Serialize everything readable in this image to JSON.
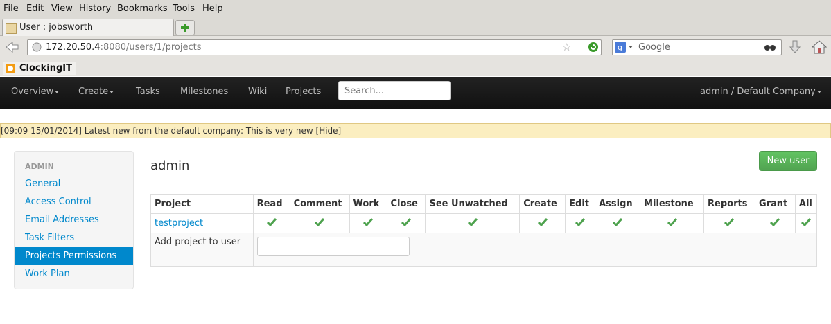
{
  "browser": {
    "menu": [
      "File",
      "Edit",
      "View",
      "History",
      "Bookmarks",
      "Tools",
      "Help"
    ],
    "tab_title": "User : jobsworth",
    "url_host": "172.20.50.4",
    "url_rest": ":8080/users/1/projects",
    "search_placeholder": "Google",
    "bookmark": "ClockingIT"
  },
  "nav": {
    "overview": "Overview",
    "create": "Create",
    "tasks": "Tasks",
    "milestones": "Milestones",
    "wiki": "Wiki",
    "projects": "Projects",
    "search_placeholder": "Search...",
    "user": "admin / Default Company"
  },
  "notice": "[09:09 15/01/2014] Latest new from the default company: This is very new [Hide]",
  "sidebar": {
    "header": "ADMIN",
    "items": [
      "General",
      "Access Control",
      "Email Addresses",
      "Task Filters",
      "Projects Permissions",
      "Work Plan"
    ],
    "active_index": 4
  },
  "page": {
    "title": "admin",
    "new_user_label": "New user"
  },
  "table": {
    "headers": [
      "Project",
      "Read",
      "Comment",
      "Work",
      "Close",
      "See Unwatched",
      "Create",
      "Edit",
      "Assign",
      "Milestone",
      "Reports",
      "Grant",
      "All"
    ],
    "rows": [
      {
        "project": "testproject",
        "perms": [
          true,
          true,
          true,
          true,
          true,
          true,
          true,
          true,
          true,
          true,
          true,
          true
        ]
      }
    ],
    "add_label": "Add project to user"
  },
  "colors": {
    "accent": "#0088cc",
    "success": "#51a351",
    "check": "#4ea24e",
    "notice_bg": "#fbeec0"
  }
}
